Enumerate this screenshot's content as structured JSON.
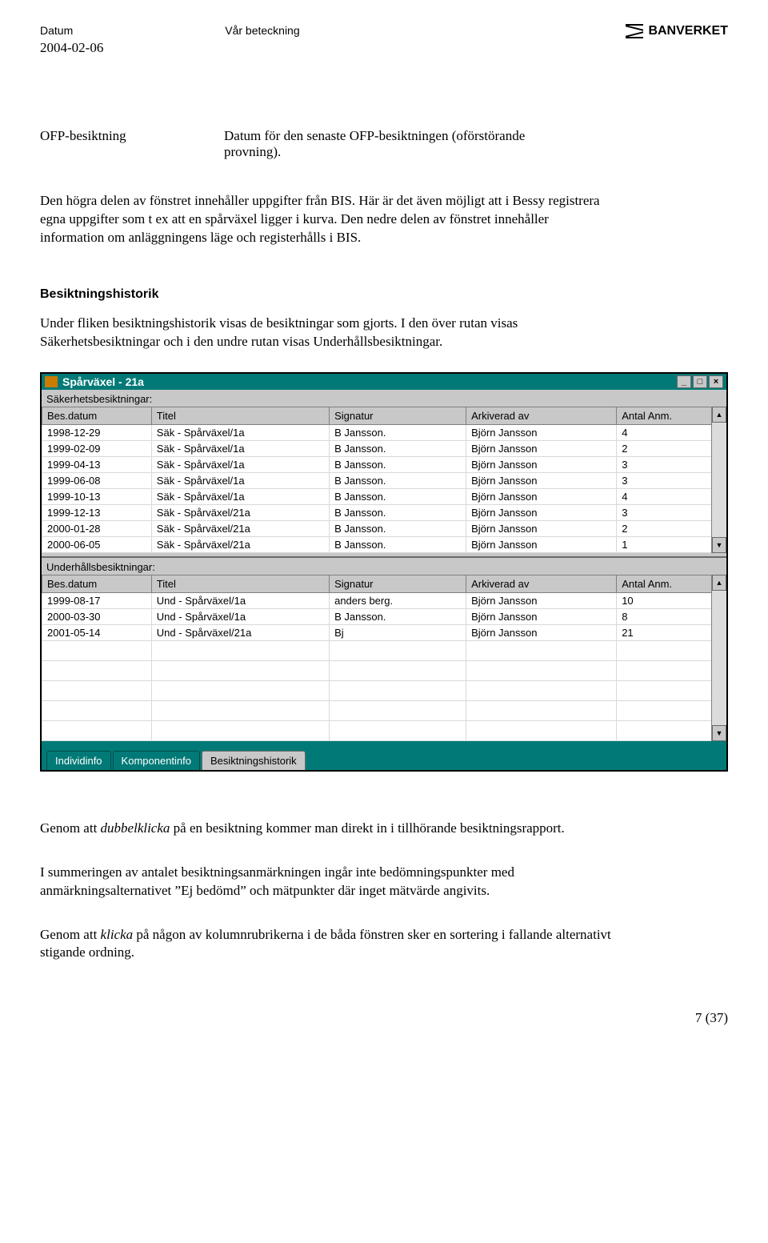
{
  "header": {
    "datum_label": "Datum",
    "beteckning_label": "Vår beteckning",
    "date": "2004-02-06",
    "brand": "BANVERKET"
  },
  "def": {
    "term": "OFP-besiktning",
    "desc": "Datum för den senaste OFP-besiktningen (oförstörande provning)."
  },
  "para1": "Den högra delen av fönstret innehåller uppgifter från BIS. Här är det även möjligt att i Bessy registrera egna uppgifter som t ex att en spårväxel ligger i kurva. Den nedre delen av fönstret innehåller information om anläggningens läge och registerhålls i BIS.",
  "section_title": "Besiktningshistorik",
  "para2": "Under fliken besiktningshistorik visas de besiktningar som gjorts. I den över rutan visas Säkerhetsbesiktningar och i den undre rutan visas Underhållsbesiktningar.",
  "window": {
    "title": "Spårväxel - 21a",
    "min": "_",
    "max": "□",
    "close": "×",
    "label_sak": "Säkerhetsbesiktningar:",
    "label_und": "Underhållsbesiktningar:",
    "cols": {
      "c1": "Bes.datum",
      "c2": "Titel",
      "c3": "Signatur",
      "c4": "Arkiverad av",
      "c5": "Antal Anm."
    },
    "sak_rows": [
      {
        "d": "1998-12-29",
        "t": "Säk - Spårväxel/1a",
        "s": "B Jansson.",
        "a": "Björn Jansson",
        "n": "4"
      },
      {
        "d": "1999-02-09",
        "t": "Säk - Spårväxel/1a",
        "s": "B Jansson.",
        "a": "Björn Jansson",
        "n": "2"
      },
      {
        "d": "1999-04-13",
        "t": "Säk - Spårväxel/1a",
        "s": "B Jansson.",
        "a": "Björn Jansson",
        "n": "3"
      },
      {
        "d": "1999-06-08",
        "t": "Säk - Spårväxel/1a",
        "s": "B Jansson.",
        "a": "Björn Jansson",
        "n": "3"
      },
      {
        "d": "1999-10-13",
        "t": "Säk - Spårväxel/1a",
        "s": "B Jansson.",
        "a": "Björn Jansson",
        "n": "4"
      },
      {
        "d": "1999-12-13",
        "t": "Säk - Spårväxel/21a",
        "s": "B Jansson.",
        "a": "Björn Jansson",
        "n": "3"
      },
      {
        "d": "2000-01-28",
        "t": "Säk - Spårväxel/21a",
        "s": "B Jansson.",
        "a": "Björn Jansson",
        "n": "2"
      },
      {
        "d": "2000-06-05",
        "t": "Säk - Spårväxel/21a",
        "s": "B Jansson.",
        "a": "Björn Jansson",
        "n": "1"
      }
    ],
    "und_rows": [
      {
        "d": "1999-08-17",
        "t": "Und - Spårväxel/1a",
        "s": "anders berg.",
        "a": "Björn Jansson",
        "n": "10"
      },
      {
        "d": "2000-03-30",
        "t": "Und - Spårväxel/1a",
        "s": "B Jansson.",
        "a": "Björn Jansson",
        "n": "8"
      },
      {
        "d": "2001-05-14",
        "t": "Und - Spårväxel/21a",
        "s": "Bj",
        "a": "Björn Jansson",
        "n": "21"
      }
    ],
    "tabs": {
      "t1": "Individinfo",
      "t2": "Komponentinfo",
      "t3": "Besiktningshistorik"
    },
    "arrow_up": "▲",
    "arrow_down": "▼"
  },
  "para3a": "Genom att ",
  "para3b": "dubbelklicka",
  "para3c": " på en besiktning kommer man direkt in i tillhörande besiktningsrapport.",
  "para4": "I summeringen av antalet besiktningsanmärkningen ingår inte bedömningspunkter med anmärkningsalternativet ”Ej bedömd” och mätpunkter där inget mätvärde angivits.",
  "para5a": "Genom att ",
  "para5b": "klicka",
  "para5c": " på någon av kolumnrubrikerna i de båda fönstren sker en sortering i fallande alternativt stigande ordning.",
  "page_num": "7 (37)"
}
